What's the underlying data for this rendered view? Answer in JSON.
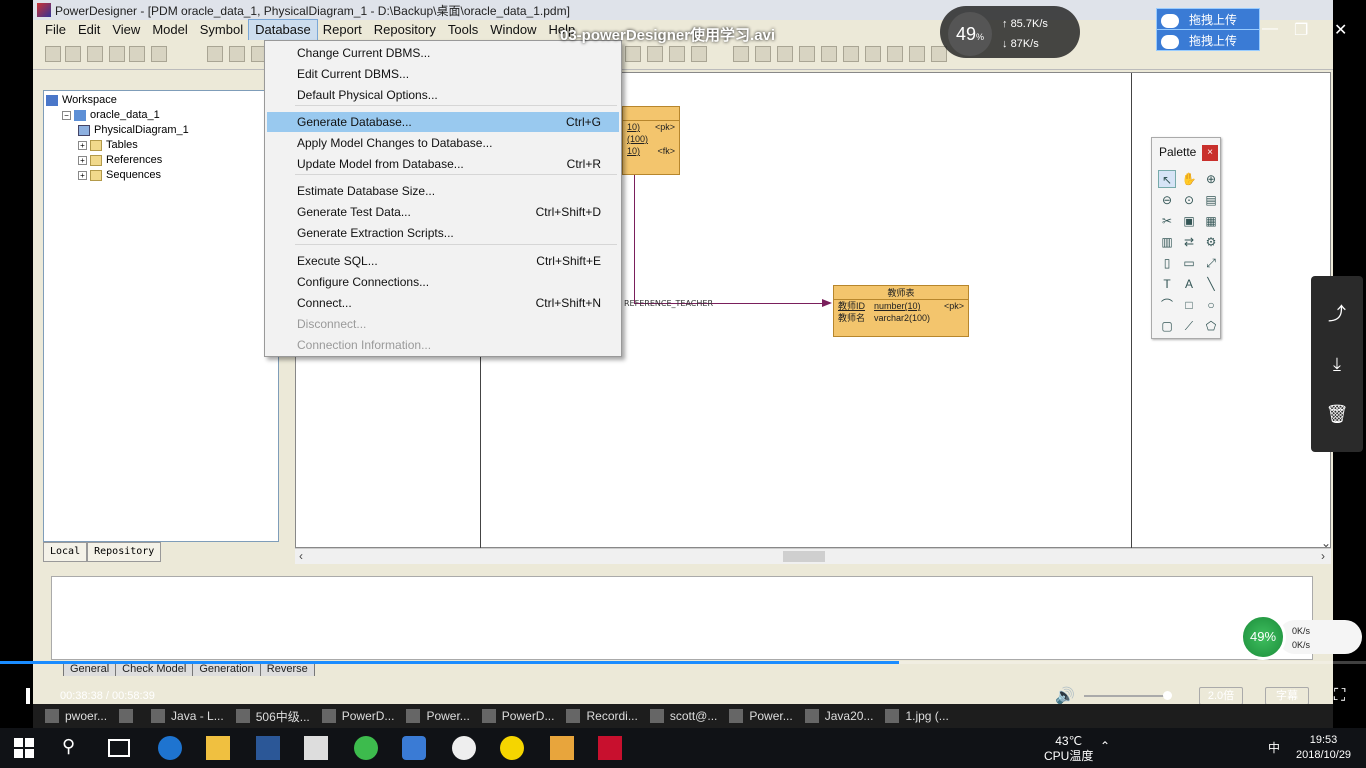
{
  "window": {
    "title": "PowerDesigner - [PDM oracle_data_1, PhysicalDiagram_1 - D:\\Backup\\桌面\\oracle_data_1.pdm]"
  },
  "menubar": {
    "items": [
      "File",
      "Edit",
      "View",
      "Model",
      "Symbol",
      "Database",
      "Report",
      "Repository",
      "Tools",
      "Window",
      "Help"
    ],
    "active": "Database"
  },
  "browser": {
    "tree": [
      {
        "label": "Workspace",
        "level": 0,
        "icon": "workspace-icon"
      },
      {
        "label": "oracle_data_1",
        "level": 1,
        "icon": "model-icon"
      },
      {
        "label": "PhysicalDiagram_1",
        "level": 2,
        "icon": "diagram-icon"
      },
      {
        "label": "Tables",
        "level": 2,
        "icon": "folder-icon"
      },
      {
        "label": "References",
        "level": 2,
        "icon": "folder-icon"
      },
      {
        "label": "Sequences",
        "level": 2,
        "icon": "folder-icon"
      }
    ],
    "tabs": [
      "Local",
      "Repository"
    ]
  },
  "database_menu": {
    "items": [
      {
        "label": "Change Current DBMS...",
        "shortcut": ""
      },
      {
        "label": "Edit Current DBMS...",
        "shortcut": ""
      },
      {
        "label": "Default Physical Options...",
        "shortcut": ""
      },
      {
        "label": "Generate Database...",
        "shortcut": "Ctrl+G",
        "highlighted": true
      },
      {
        "label": "Apply Model Changes to Database...",
        "shortcut": ""
      },
      {
        "label": "Update Model from Database...",
        "shortcut": "Ctrl+R"
      },
      {
        "label": "Estimate Database Size...",
        "shortcut": ""
      },
      {
        "label": "Generate Test Data...",
        "shortcut": "Ctrl+Shift+D"
      },
      {
        "label": "Generate Extraction Scripts...",
        "shortcut": ""
      },
      {
        "label": "Execute SQL...",
        "shortcut": "Ctrl+Shift+E"
      },
      {
        "label": "Configure Connections...",
        "shortcut": ""
      },
      {
        "label": "Connect...",
        "shortcut": "Ctrl+Shift+N"
      },
      {
        "label": "Disconnect...",
        "shortcut": "",
        "disabled": true
      },
      {
        "label": "Connection Information...",
        "shortcut": "",
        "disabled": true
      }
    ]
  },
  "diagram": {
    "student_table_fragment": {
      "rows": [
        {
          "c1": "10)",
          "c3": "<pk>"
        },
        {
          "c1": "(100)",
          "c3": ""
        },
        {
          "c1": "10)",
          "c3": "<fk>"
        }
      ]
    },
    "reference_label": "REFERENCE_TEACHER",
    "teacher_table": {
      "name": "教师表",
      "columns": [
        {
          "name": "教师ID",
          "type": "number(10)",
          "key": "<pk>"
        },
        {
          "name": "教师名",
          "type": "varchar2(100)",
          "key": ""
        }
      ]
    }
  },
  "palette": {
    "title": "Palette",
    "close": "×",
    "tools": [
      "pointer-icon",
      "grabber-icon",
      "zoom-in-icon",
      "zoom-out-icon",
      "open-view-icon",
      "properties-icon",
      "delete-icon",
      "package-icon",
      "table-icon",
      "view-icon",
      "reference-icon",
      "procedure-icon",
      "file-icon",
      "note-icon",
      "link-icon",
      "title-icon",
      "text-icon",
      "line-icon",
      "arc-icon",
      "rectangle-icon",
      "ellipse-icon",
      "rounded-rect-icon",
      "polyline-icon",
      "polygon-icon"
    ]
  },
  "output": {
    "tabs": [
      "General",
      "Check Model",
      "Generation",
      "Reverse"
    ]
  },
  "player": {
    "video_title": "03-powerDesigner使用学习.avi",
    "time": "00:38:38 / 00:58:39",
    "progress": 0.658,
    "volume": 0.97,
    "speed": "2.0倍",
    "subtitles": "字幕",
    "net_percent": "49",
    "net_percent_unit": "%",
    "net_up": "85.7",
    "net_down": "87",
    "net_unit": "K/s",
    "upload_button": "拖拽上传",
    "speed_widget_percent": "49%",
    "speed_widget_up": "0K/s",
    "speed_widget_down": "0K/s"
  },
  "inner_taskbar": {
    "items": [
      "pwoer...",
      "",
      "Java - L...",
      "506中级...",
      "PowerD...",
      "Power...",
      "PowerD...",
      "Recordi...",
      "scott@...",
      "Power...",
      "Java20...",
      "1.jpg (..."
    ]
  },
  "system_tray": {
    "temperature": "43℃",
    "temperature_label": "CPU温度",
    "ime": "中",
    "time": "19:53",
    "date": "2018/10/29"
  },
  "colors": {
    "menu_highlight": "#99c9ef",
    "entity_fill": "#f3c56d",
    "progress_fill": "#1a8cff"
  }
}
